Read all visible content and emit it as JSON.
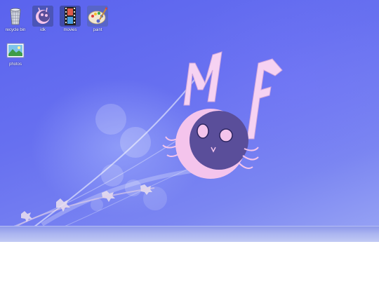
{
  "desktop": {
    "icons": [
      {
        "label": "recycle bin",
        "icon": "recycle-bin-icon"
      },
      {
        "label": "idk",
        "icon": "idk-icon"
      },
      {
        "label": "movies",
        "icon": "movies-icon"
      },
      {
        "label": "paint",
        "icon": "paint-palette-icon"
      },
      {
        "label": "photos",
        "icon": "photos-icon"
      }
    ],
    "colors": {
      "wallpaper_base": "#6770f0",
      "logo_pink": "#f5c8f0",
      "logo_dark": "#5a4e9a"
    }
  }
}
